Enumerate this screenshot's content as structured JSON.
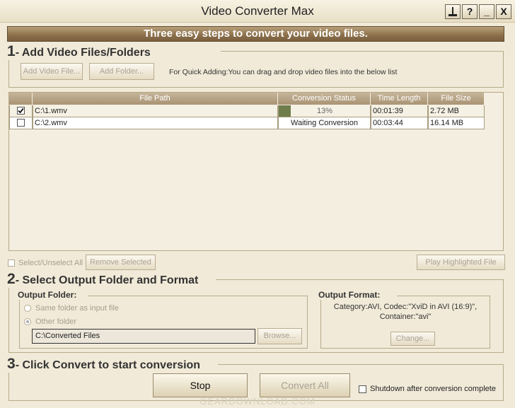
{
  "window": {
    "title": "Video Converter Max",
    "buttons": [
      "?",
      "_",
      "X"
    ]
  },
  "banner": "Three easy steps to convert your video files.",
  "step1": {
    "number": "1",
    "title": "- Add Video Files/Folders",
    "add_file_label": "Add Video File...",
    "add_folder_label": "Add Folder...",
    "hint": "For Quick Adding:You can drag and drop video files into the below list"
  },
  "table": {
    "columns": [
      "File Path",
      "Conversion Status",
      "Time Length",
      "File Size"
    ],
    "rows": [
      {
        "checked": true,
        "path": "C:\\1.wmv",
        "status": "13%",
        "progress": 0.13,
        "time": "00:01:39",
        "size": "2.72 MB"
      },
      {
        "checked": false,
        "path": "C:\\2.wmv",
        "status": "Waiting Conversion",
        "time": "00:03:44",
        "size": "16.14 MB"
      }
    ]
  },
  "list_actions": {
    "select_all_label": "Select/Unselect All",
    "remove_selected_label": "Remove Selected",
    "play_highlighted_label": "Play Highlighted File"
  },
  "step2": {
    "number": "2",
    "title": "- Select Output Folder and Format",
    "output_folder_title": "Output Folder:",
    "same_folder_label": "Same folder as input file",
    "other_folder_label": "Other folder",
    "folder_path": "C:\\Converted Files",
    "browse_label": "Browse...",
    "output_format_title": "Output Format:",
    "format_line1": "Category:AVI, Codec:\"XviD in AVI (16:9)\",",
    "format_line2": "Container:\"avi\"",
    "change_label": "Change..."
  },
  "step3": {
    "number": "3",
    "title": "- Click Convert to start conversion",
    "stop_label": "Stop",
    "convert_all_label": "Convert All",
    "shutdown_label": "Shutdown after conversion complete"
  },
  "watermark": "GEARDOWNLOAD.COM"
}
